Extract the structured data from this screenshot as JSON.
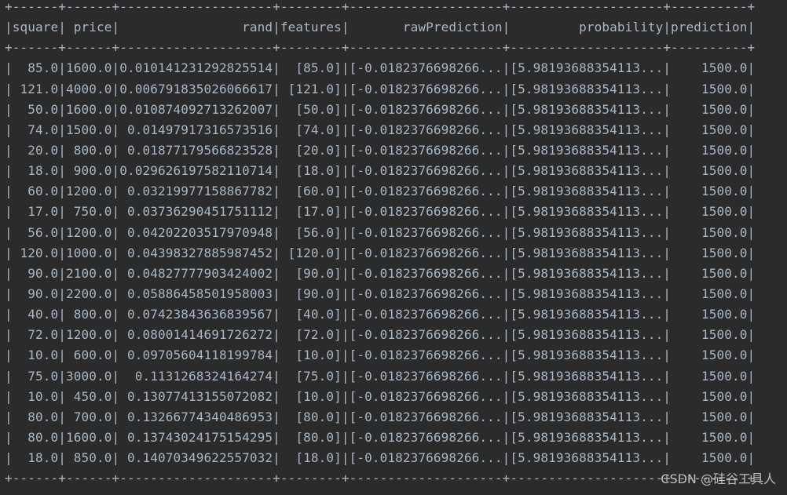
{
  "output": {
    "separator": "+------+------+--------------------+--------+--------------------+--------------------+----------+",
    "header": "|square| price|                rand|features|       rawPrediction|         probability|prediction|",
    "rows": [
      "|  85.0|1600.0|0.010141231292825514|  [85.0]|[-0.0182376698266...|[5.98193688354113...|    1500.0|",
      "| 121.0|4000.0|0.006791835026066617| [121.0]|[-0.0182376698266...|[5.98193688354113...|    1500.0|",
      "|  50.0|1600.0|0.010874092713262007|  [50.0]|[-0.0182376698266...|[5.98193688354113...|    1500.0|",
      "|  74.0|1500.0| 0.01497917316573516|  [74.0]|[-0.0182376698266...|[5.98193688354113...|    1500.0|",
      "|  20.0| 800.0| 0.01877179566823528|  [20.0]|[-0.0182376698266...|[5.98193688354113...|    1500.0|",
      "|  18.0| 900.0|0.029626197582110714|  [18.0]|[-0.0182376698266...|[5.98193688354113...|    1500.0|",
      "|  60.0|1200.0| 0.03219977158867782|  [60.0]|[-0.0182376698266...|[5.98193688354113...|    1500.0|",
      "|  17.0| 750.0| 0.03736290451751112|  [17.0]|[-0.0182376698266...|[5.98193688354113...|    1500.0|",
      "|  56.0|1200.0| 0.04202203517970948|  [56.0]|[-0.0182376698266...|[5.98193688354113...|    1500.0|",
      "| 120.0|1000.0| 0.04398327885987452| [120.0]|[-0.0182376698266...|[5.98193688354113...|    1500.0|",
      "|  90.0|2100.0| 0.04827777903424002|  [90.0]|[-0.0182376698266...|[5.98193688354113...|    1500.0|",
      "|  90.0|2200.0| 0.05886458501958003|  [90.0]|[-0.0182376698266...|[5.98193688354113...|    1500.0|",
      "|  40.0| 800.0| 0.07423843636839567|  [40.0]|[-0.0182376698266...|[5.98193688354113...|    1500.0|",
      "|  72.0|1200.0| 0.08001414691726272|  [72.0]|[-0.0182376698266...|[5.98193688354113...|    1500.0|",
      "|  10.0| 600.0| 0.09705604118199784|  [10.0]|[-0.0182376698266...|[5.98193688354113...|    1500.0|",
      "|  75.0|3000.0|  0.1131268324164274|  [75.0]|[-0.0182376698266...|[5.98193688354113...|    1500.0|",
      "|  10.0| 450.0| 0.13077413155072082|  [10.0]|[-0.0182376698266...|[5.98193688354113...|    1500.0|",
      "|  80.0| 700.0| 0.13266774340486953|  [80.0]|[-0.0182376698266...|[5.98193688354113...|    1500.0|",
      "|  80.0|1600.0| 0.13743024175154295|  [80.0]|[-0.0182376698266...|[5.98193688354113...|    1500.0|",
      "|  18.0| 850.0| 0.14070349622557032|  [18.0]|[-0.0182376698266...|[5.98193688354113...|    1500.0|"
    ]
  },
  "watermark": "CSDN @硅谷工具人"
}
